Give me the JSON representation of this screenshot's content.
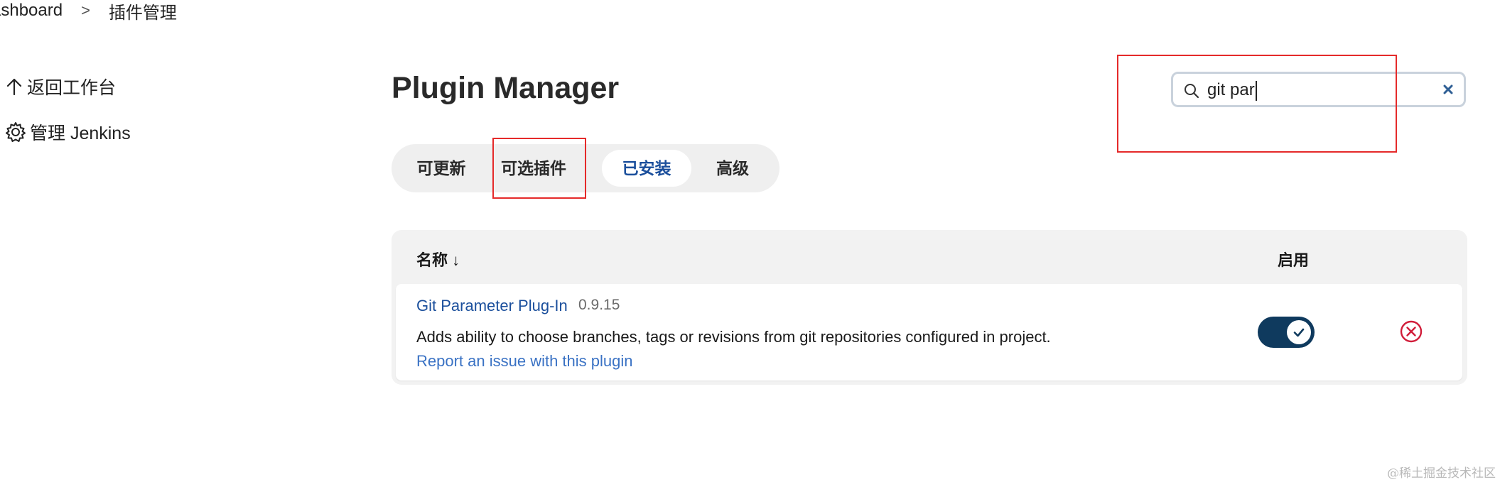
{
  "breadcrumb": {
    "first": "ashboard",
    "separator": ">",
    "current": "插件管理"
  },
  "side_menu": [
    {
      "label": "返回工作台",
      "icon": "up-arrow-icon"
    },
    {
      "label": "管理 Jenkins",
      "icon": "gear-icon"
    }
  ],
  "page": {
    "title": "Plugin Manager"
  },
  "tabs": [
    {
      "label": "可更新",
      "active": false
    },
    {
      "label": "可选插件",
      "active": false
    },
    {
      "label": "已安装",
      "active": true
    },
    {
      "label": "高级",
      "active": false
    }
  ],
  "search": {
    "value": "git par",
    "icon": "search-icon",
    "clear_icon": "close-icon"
  },
  "table": {
    "headers": {
      "name": "名称 ↓",
      "enabled": "启用"
    },
    "rows": [
      {
        "name": "Git Parameter Plug-In",
        "version": "0.9.15",
        "description": "Adds ability to choose branches, tags or revisions from git repositories configured in project.",
        "report_link": "Report an issue with this plugin",
        "enabled": true
      }
    ]
  },
  "watermark": "@稀土掘金技术社区",
  "colors": {
    "accent": "#1b4f9c",
    "toggle": "#0f3a5e",
    "danger": "#d11d3a",
    "highlight_box": "#e52a2a"
  }
}
